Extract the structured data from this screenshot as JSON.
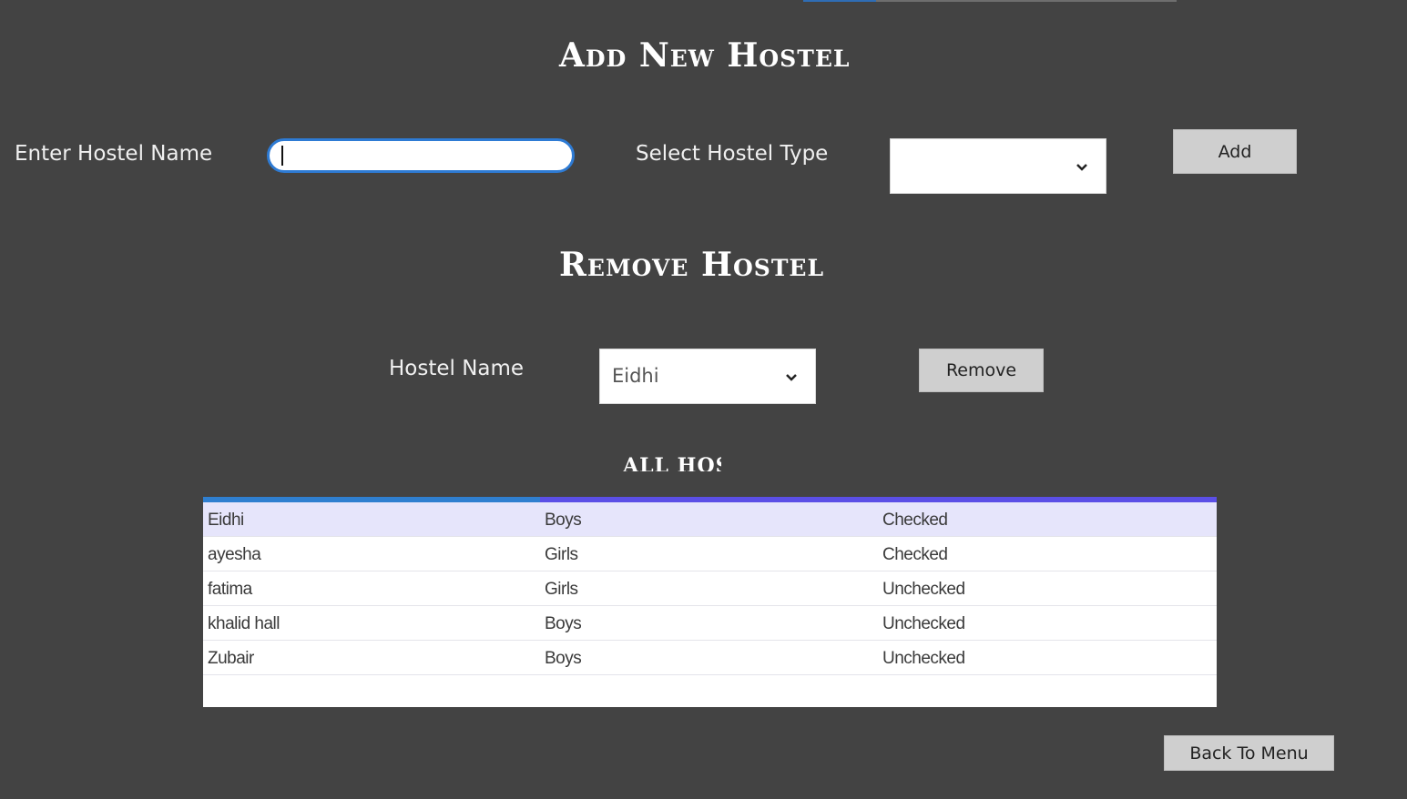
{
  "add_section": {
    "title": "Add New Hostel",
    "hostel_name_label": "Enter Hostel Name",
    "hostel_name_value": "",
    "hostel_type_label": "Select Hostel Type",
    "hostel_type_value": "",
    "add_button": "Add"
  },
  "remove_section": {
    "title": "Remove Hostel",
    "hostel_name_label": "Hostel Name",
    "hostel_name_value": "Eidhi",
    "remove_button": "Remove"
  },
  "all_section": {
    "title": "ALL HOST",
    "rows": [
      {
        "name": "Eidhi",
        "type": "Boys",
        "status": "Checked"
      },
      {
        "name": "ayesha",
        "type": "Girls",
        "status": "Checked"
      },
      {
        "name": "fatima",
        "type": "Girls",
        "status": "Unchecked"
      },
      {
        "name": "khalid hall",
        "type": "Boys",
        "status": "Unchecked"
      },
      {
        "name": "Zubair",
        "type": "Boys",
        "status": "Unchecked"
      }
    ]
  },
  "back_button": "Back To Menu",
  "colors": {
    "background": "#434343",
    "input_border": "#2e7bd4",
    "grid_header_left": "#2f7fd0",
    "grid_header_right": "#5b4fe6",
    "selected_row": "#e6e5fb"
  },
  "icons": {
    "dropdown": "chevron-down-icon"
  }
}
